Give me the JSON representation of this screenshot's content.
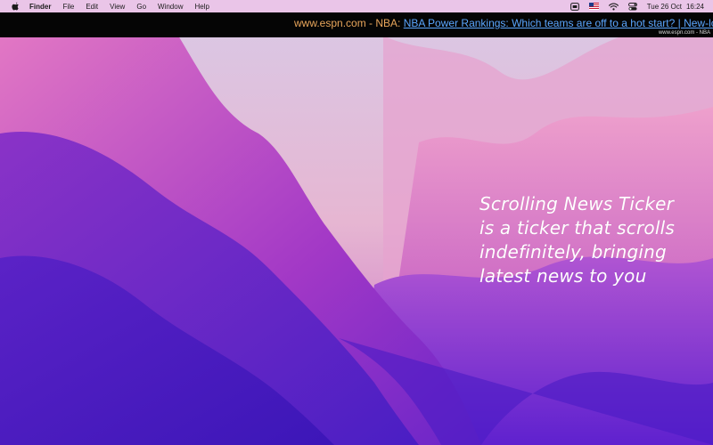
{
  "menubar": {
    "app_name": "Finder",
    "items": [
      "File",
      "Edit",
      "View",
      "Go",
      "Window",
      "Help"
    ],
    "status_icons": [
      "ticker-app-icon",
      "flag-icon",
      "wifi-icon",
      "control-center-icon"
    ],
    "date": "Tue 26 Oct",
    "time": "16:24"
  },
  "ticker": {
    "source": "www.espn.com - NBA: ",
    "headline": "NBA Power Rankings: Which teams are off to a hot start? | New-look Bul",
    "caption": "www.espn.com - NBA"
  },
  "promo": {
    "lines": [
      "Scrolling News Ticker",
      "is a ticker that scrolls",
      "indefinitely, bringing",
      "latest news to you"
    ]
  },
  "colors": {
    "ticker_bg": "#050505",
    "source_text": "#e9a65b",
    "headline_link": "#5aa6ff",
    "wallpaper_purple": "#6a2bd8",
    "wallpaper_pink": "#e37ec0"
  }
}
